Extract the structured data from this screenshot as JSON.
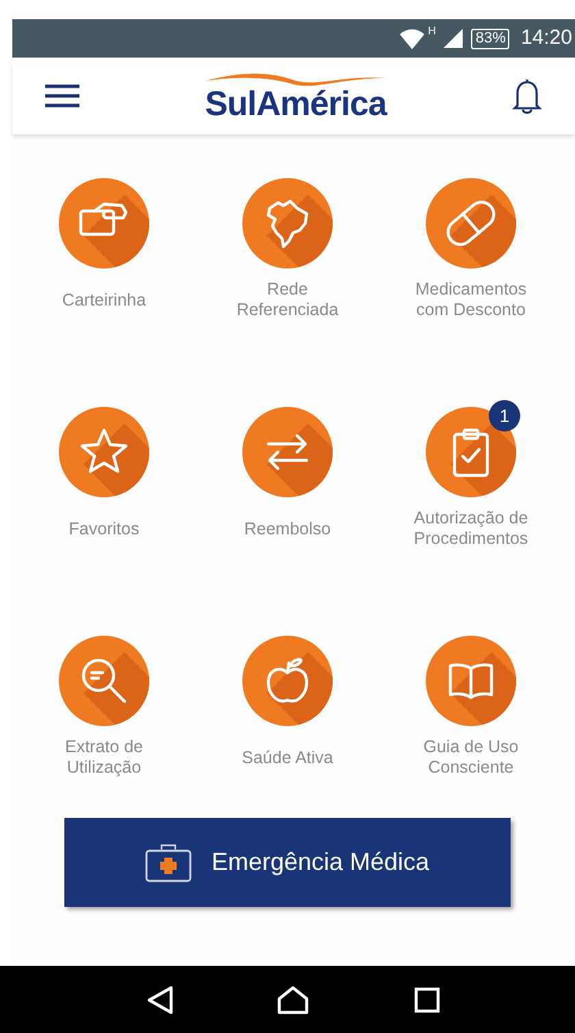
{
  "status_bar": {
    "network": "H",
    "battery": "83%",
    "time": "14:20"
  },
  "header": {
    "logo": "SulAmérica"
  },
  "menu_items": [
    {
      "label": "Carteirinha"
    },
    {
      "label": "Rede\nReferenciada"
    },
    {
      "label": "Medicamentos\ncom Desconto"
    },
    {
      "label": "Favoritos"
    },
    {
      "label": "Reembolso"
    },
    {
      "label": "Autorização de\nProcedimentos",
      "badge": "1"
    },
    {
      "label": "Extrato de\nUtilização"
    },
    {
      "label": "Saúde Ativa"
    },
    {
      "label": "Guia de Uso\nConsciente"
    }
  ],
  "emergency_button": {
    "label": "Emergência Médica"
  }
}
